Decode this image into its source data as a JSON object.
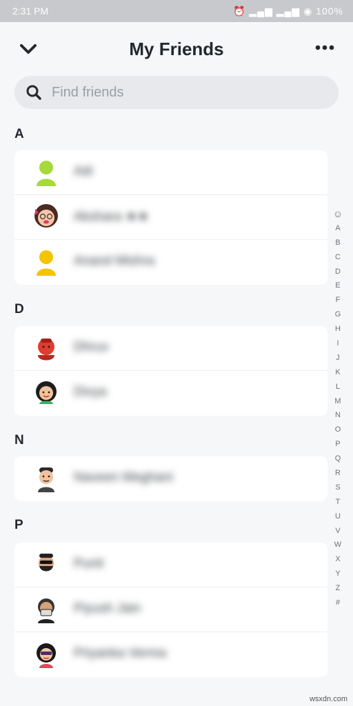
{
  "status": {
    "time": "2:31 PM",
    "icons": "⏰ ▂▄▆ ▂▄▆ ◉ 100%"
  },
  "header": {
    "title": "My Friends"
  },
  "search": {
    "placeholder": "Find friends"
  },
  "sections": [
    {
      "letter": "A",
      "friends": [
        {
          "name": "Adi"
        },
        {
          "name": "Akshara ★★"
        },
        {
          "name": "Anand Mishra"
        }
      ]
    },
    {
      "letter": "D",
      "friends": [
        {
          "name": "Dhruv"
        },
        {
          "name": "Divya"
        }
      ]
    },
    {
      "letter": "N",
      "friends": [
        {
          "name": "Naveen Meghani"
        }
      ]
    },
    {
      "letter": "P",
      "friends": [
        {
          "name": "Punit"
        },
        {
          "name": "Piyush Jain"
        },
        {
          "name": "Priyanka Verma"
        }
      ]
    }
  ],
  "index_letters": [
    "☺",
    "A",
    "B",
    "C",
    "D",
    "E",
    "F",
    "G",
    "H",
    "I",
    "J",
    "K",
    "L",
    "M",
    "N",
    "O",
    "P",
    "Q",
    "R",
    "S",
    "T",
    "U",
    "V",
    "W",
    "X",
    "Y",
    "Z",
    "#"
  ],
  "watermark": "wsxdn.com",
  "colors": {
    "background": "#f6f7f9",
    "card": "#ffffff",
    "search_bg": "#e7e9ec",
    "text": "#24282c"
  }
}
